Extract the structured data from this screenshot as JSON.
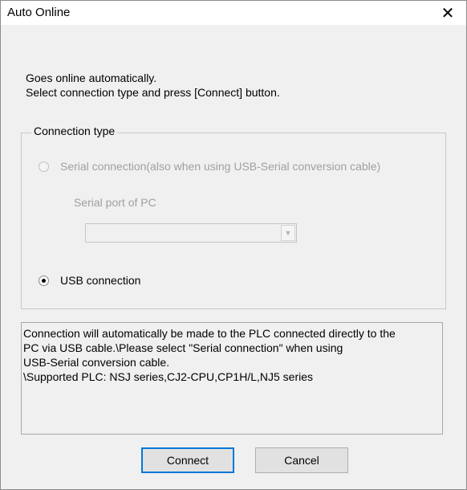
{
  "window": {
    "title": "Auto Online",
    "close_glyph": "✕"
  },
  "intro": {
    "line1": "Goes online automatically.",
    "line2": "Select connection type and press [Connect] button."
  },
  "connection_type": {
    "legend": "Connection type",
    "serial": {
      "label": "Serial connection(also when using USB-Serial conversion cable)",
      "selected": false,
      "enabled": false
    },
    "serial_port_label": "Serial port of PC",
    "serial_port_value": "",
    "usb": {
      "label": "USB connection",
      "selected": true,
      "enabled": true
    }
  },
  "info": {
    "line1": "Connection will automatically be made to the PLC connected directly to the",
    "line2": "PC via USB cable.\\Please select \"Serial connection\" when using",
    "line3": "USB-Serial conversion cable.",
    "line4": "\\Supported PLC: NSJ series,CJ2-CPU,CP1H/L,NJ5 series"
  },
  "buttons": {
    "connect": "Connect",
    "cancel": "Cancel"
  },
  "icons": {
    "close": "close-icon",
    "combo_arrow": "chevron-down-icon"
  }
}
